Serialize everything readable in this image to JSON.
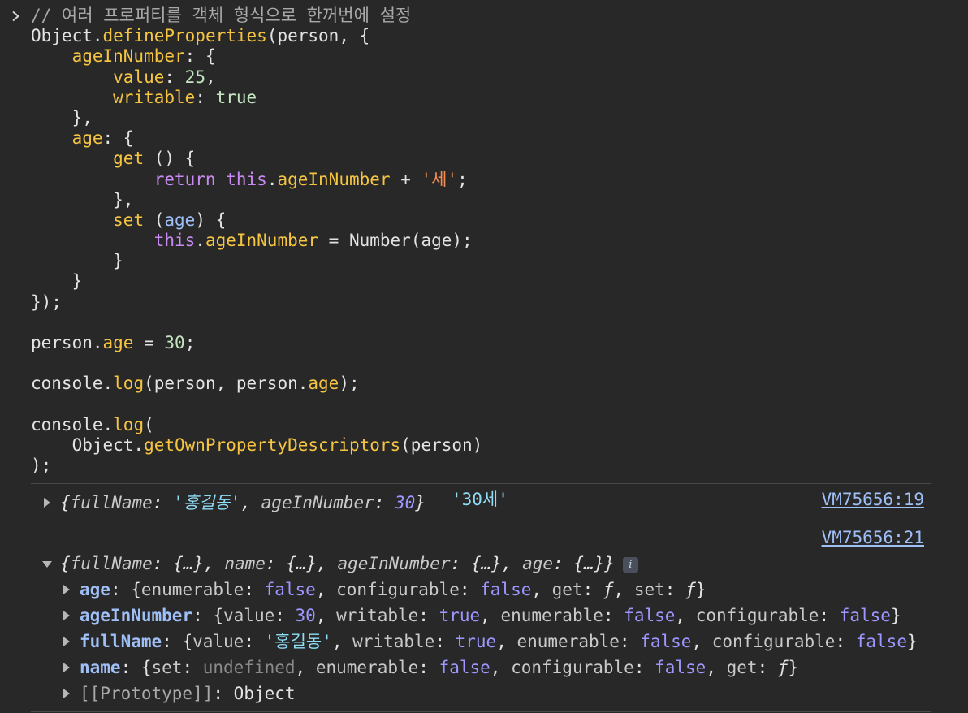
{
  "input": {
    "lines": [
      [
        {
          "t": "comment",
          "v": "// 여러 프로퍼티를 객체 형식으로 한꺼번에 설정"
        }
      ],
      [
        {
          "t": "plain",
          "v": "Object."
        },
        {
          "t": "prop",
          "v": "defineProperties"
        },
        {
          "t": "plain",
          "v": "(person, {"
        }
      ],
      [
        {
          "t": "plain",
          "v": "    "
        },
        {
          "t": "prop",
          "v": "ageInNumber"
        },
        {
          "t": "plain",
          "v": ": {"
        }
      ],
      [
        {
          "t": "plain",
          "v": "        "
        },
        {
          "t": "prop",
          "v": "value"
        },
        {
          "t": "plain",
          "v": ": "
        },
        {
          "t": "num",
          "v": "25"
        },
        {
          "t": "plain",
          "v": ","
        }
      ],
      [
        {
          "t": "plain",
          "v": "        "
        },
        {
          "t": "prop",
          "v": "writable"
        },
        {
          "t": "plain",
          "v": ": "
        },
        {
          "t": "num",
          "v": "true"
        }
      ],
      [
        {
          "t": "plain",
          "v": "    },"
        }
      ],
      [
        {
          "t": "plain",
          "v": "    "
        },
        {
          "t": "prop",
          "v": "age"
        },
        {
          "t": "plain",
          "v": ": {"
        }
      ],
      [
        {
          "t": "plain",
          "v": "        "
        },
        {
          "t": "prop",
          "v": "get"
        },
        {
          "t": "plain",
          "v": " () {"
        }
      ],
      [
        {
          "t": "plain",
          "v": "            "
        },
        {
          "t": "kw",
          "v": "return"
        },
        {
          "t": "plain",
          "v": " "
        },
        {
          "t": "kw",
          "v": "this"
        },
        {
          "t": "plain",
          "v": "."
        },
        {
          "t": "prop",
          "v": "ageInNumber"
        },
        {
          "t": "plain",
          "v": " + "
        },
        {
          "t": "str",
          "v": "'세'"
        },
        {
          "t": "plain",
          "v": ";"
        }
      ],
      [
        {
          "t": "plain",
          "v": "        },"
        }
      ],
      [
        {
          "t": "plain",
          "v": "        "
        },
        {
          "t": "prop",
          "v": "set"
        },
        {
          "t": "plain",
          "v": " ("
        },
        {
          "t": "var",
          "v": "age"
        },
        {
          "t": "plain",
          "v": ") {"
        }
      ],
      [
        {
          "t": "plain",
          "v": "            "
        },
        {
          "t": "kw",
          "v": "this"
        },
        {
          "t": "plain",
          "v": "."
        },
        {
          "t": "prop",
          "v": "ageInNumber"
        },
        {
          "t": "plain",
          "v": " = Number(age);"
        }
      ],
      [
        {
          "t": "plain",
          "v": "        }"
        }
      ],
      [
        {
          "t": "plain",
          "v": "    }"
        }
      ],
      [
        {
          "t": "plain",
          "v": "});"
        }
      ],
      [
        {
          "t": "plain",
          "v": ""
        }
      ],
      [
        {
          "t": "plain",
          "v": "person."
        },
        {
          "t": "prop",
          "v": "age"
        },
        {
          "t": "plain",
          "v": " = "
        },
        {
          "t": "num",
          "v": "30"
        },
        {
          "t": "plain",
          "v": ";"
        }
      ],
      [
        {
          "t": "plain",
          "v": ""
        }
      ],
      [
        {
          "t": "plain",
          "v": "console."
        },
        {
          "t": "prop",
          "v": "log"
        },
        {
          "t": "plain",
          "v": "(person, person."
        },
        {
          "t": "prop",
          "v": "age"
        },
        {
          "t": "plain",
          "v": ");"
        }
      ],
      [
        {
          "t": "plain",
          "v": ""
        }
      ],
      [
        {
          "t": "plain",
          "v": "console."
        },
        {
          "t": "prop",
          "v": "log"
        },
        {
          "t": "plain",
          "v": "("
        }
      ],
      [
        {
          "t": "plain",
          "v": "    Object."
        },
        {
          "t": "prop",
          "v": "getOwnPropertyDescriptors"
        },
        {
          "t": "plain",
          "v": "(person)"
        }
      ],
      [
        {
          "t": "plain",
          "v": ");"
        }
      ]
    ]
  },
  "output1": {
    "open_brace": "{",
    "k1": "fullName",
    "colon": ": ",
    "v1": "'홍길동'",
    "sep": ", ",
    "k2": "ageInNumber",
    "v2": "30",
    "close_brace": "}",
    "age_value": "'30세'",
    "source": "VM75656:19"
  },
  "output2": {
    "source": "VM75656:21",
    "summary": {
      "open": "{",
      "k1": "fullName",
      "k2": "name",
      "k3": "ageInNumber",
      "k4": "age",
      "ell": "{…}",
      "close": "}",
      "badge": "i"
    },
    "rows": [
      {
        "key": "age",
        "parts": [
          {
            "c": "text",
            "v": ": {"
          },
          {
            "c": "prop",
            "v": "enumerable"
          },
          {
            "c": "text",
            "v": ": "
          },
          {
            "c": "bool",
            "v": "false"
          },
          {
            "c": "text",
            "v": ", "
          },
          {
            "c": "prop",
            "v": "configurable"
          },
          {
            "c": "text",
            "v": ": "
          },
          {
            "c": "bool",
            "v": "false"
          },
          {
            "c": "text",
            "v": ", "
          },
          {
            "c": "prop",
            "v": "get"
          },
          {
            "c": "text",
            "v": ": "
          },
          {
            "c": "fn",
            "v": "ƒ"
          },
          {
            "c": "text",
            "v": ", "
          },
          {
            "c": "prop",
            "v": "set"
          },
          {
            "c": "text",
            "v": ": "
          },
          {
            "c": "fn",
            "v": "ƒ"
          },
          {
            "c": "text",
            "v": "}"
          }
        ]
      },
      {
        "key": "ageInNumber",
        "parts": [
          {
            "c": "text",
            "v": ": {"
          },
          {
            "c": "prop",
            "v": "value"
          },
          {
            "c": "text",
            "v": ": "
          },
          {
            "c": "num",
            "v": "30"
          },
          {
            "c": "text",
            "v": ", "
          },
          {
            "c": "prop",
            "v": "writable"
          },
          {
            "c": "text",
            "v": ": "
          },
          {
            "c": "bool",
            "v": "true"
          },
          {
            "c": "text",
            "v": ", "
          },
          {
            "c": "prop",
            "v": "enumerable"
          },
          {
            "c": "text",
            "v": ": "
          },
          {
            "c": "bool",
            "v": "false"
          },
          {
            "c": "text",
            "v": ", "
          },
          {
            "c": "prop",
            "v": "configurable"
          },
          {
            "c": "text",
            "v": ": "
          },
          {
            "c": "bool",
            "v": "false"
          },
          {
            "c": "text",
            "v": "}"
          }
        ]
      },
      {
        "key": "fullName",
        "parts": [
          {
            "c": "text",
            "v": ": {"
          },
          {
            "c": "prop",
            "v": "value"
          },
          {
            "c": "text",
            "v": ": "
          },
          {
            "c": "str",
            "v": "'홍길동'"
          },
          {
            "c": "text",
            "v": ", "
          },
          {
            "c": "prop",
            "v": "writable"
          },
          {
            "c": "text",
            "v": ": "
          },
          {
            "c": "bool",
            "v": "true"
          },
          {
            "c": "text",
            "v": ", "
          },
          {
            "c": "prop",
            "v": "enumerable"
          },
          {
            "c": "text",
            "v": ": "
          },
          {
            "c": "bool",
            "v": "false"
          },
          {
            "c": "text",
            "v": ", "
          },
          {
            "c": "prop",
            "v": "configurable"
          },
          {
            "c": "text",
            "v": ": "
          },
          {
            "c": "bool",
            "v": "false"
          },
          {
            "c": "text",
            "v": "}"
          }
        ]
      },
      {
        "key": "name",
        "parts": [
          {
            "c": "text",
            "v": ": {"
          },
          {
            "c": "prop",
            "v": "set"
          },
          {
            "c": "text",
            "v": ": "
          },
          {
            "c": "undef",
            "v": "undefined"
          },
          {
            "c": "text",
            "v": ", "
          },
          {
            "c": "prop",
            "v": "enumerable"
          },
          {
            "c": "text",
            "v": ": "
          },
          {
            "c": "bool",
            "v": "false"
          },
          {
            "c": "text",
            "v": ", "
          },
          {
            "c": "prop",
            "v": "configurable"
          },
          {
            "c": "text",
            "v": ": "
          },
          {
            "c": "bool",
            "v": "false"
          },
          {
            "c": "text",
            "v": ", "
          },
          {
            "c": "prop",
            "v": "get"
          },
          {
            "c": "text",
            "v": ": "
          },
          {
            "c": "fn",
            "v": "ƒ"
          },
          {
            "c": "text",
            "v": "}"
          }
        ]
      }
    ],
    "prototype": {
      "key": "[[Prototype]]",
      "sep": ": ",
      "value": "Object"
    }
  }
}
